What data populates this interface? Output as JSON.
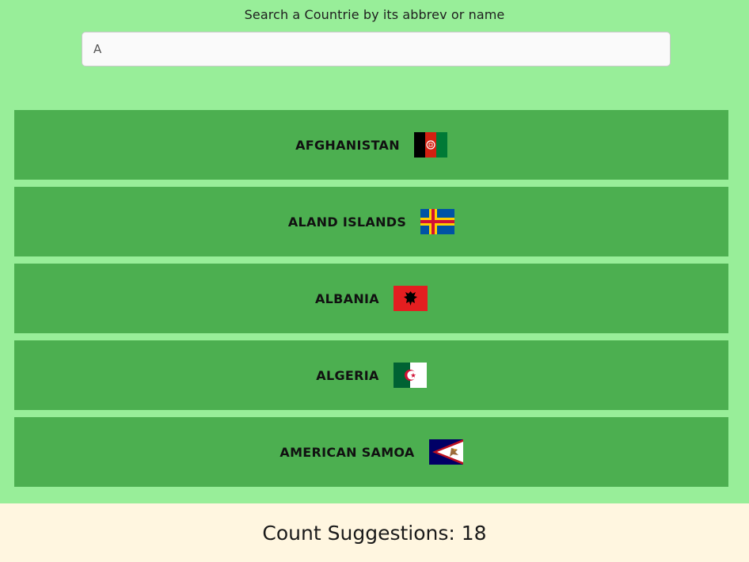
{
  "search": {
    "label": "Search a Countrie by its abbrev or name",
    "value": "A"
  },
  "results": [
    {
      "name": "AFGHANISTAN",
      "flag_icon": "afghanistan-flag"
    },
    {
      "name": "ALAND ISLANDS",
      "flag_icon": "aland-islands-flag"
    },
    {
      "name": "ALBANIA",
      "flag_icon": "albania-flag"
    },
    {
      "name": "ALGERIA",
      "flag_icon": "algeria-flag"
    },
    {
      "name": "AMERICAN SAMOA",
      "flag_icon": "american-samoa-flag"
    }
  ],
  "footer": {
    "count_text": "Count Suggestions: 18"
  },
  "colors": {
    "page_background": "#98ee99",
    "row_background": "#4caf50",
    "footer_background": "#fff6e0"
  }
}
